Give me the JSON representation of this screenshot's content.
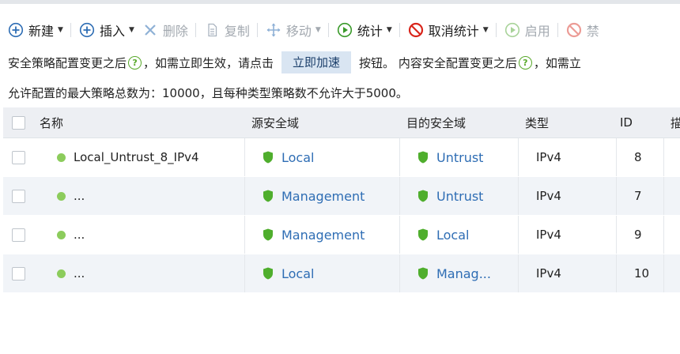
{
  "toolbar": {
    "items": [
      {
        "label": "新建",
        "icon": "plus-circle-icon",
        "disabled": false,
        "dropdown": true
      },
      {
        "label": "插入",
        "icon": "plus-circle-icon",
        "disabled": false,
        "dropdown": true
      },
      {
        "label": "删除",
        "icon": "x-icon",
        "disabled": true,
        "dropdown": false
      },
      {
        "label": "复制",
        "icon": "copy-icon",
        "disabled": true,
        "dropdown": false
      },
      {
        "label": "移动",
        "icon": "move-icon",
        "disabled": true,
        "dropdown": true
      },
      {
        "label": "统计",
        "icon": "play-circle-icon",
        "disabled": false,
        "dropdown": true
      },
      {
        "label": "取消统计",
        "icon": "no-entry-icon",
        "disabled": false,
        "dropdown": true
      },
      {
        "label": "启用",
        "icon": "play-circle-icon",
        "disabled": true,
        "dropdown": false
      },
      {
        "label": "禁",
        "icon": "no-entry-icon",
        "disabled": true,
        "dropdown": false
      }
    ]
  },
  "info": {
    "part1": "安全策略配置变更之后",
    "part2": "，如需立即生效，请点击",
    "accelerate_button": "立即加速",
    "part3": "按钮。 内容安全配置变更之后",
    "part4": "，如需立"
  },
  "limit_text": "允许配置的最大策略总数为：10000，且每种类型策略数不允许大于5000。",
  "table": {
    "headers": {
      "name": "名称",
      "source_zone": "源安全域",
      "dest_zone": "目的安全域",
      "type": "类型",
      "id": "ID",
      "more": "描"
    },
    "rows": [
      {
        "name": "Local_Untrust_8_IPv4",
        "source_zone": "Local",
        "dest_zone": "Untrust",
        "type": "IPv4",
        "id": "8"
      },
      {
        "name": "...",
        "source_zone": "Management",
        "dest_zone": "Untrust",
        "type": "IPv4",
        "id": "7"
      },
      {
        "name": "...",
        "source_zone": "Management",
        "dest_zone": "Local",
        "type": "IPv4",
        "id": "9"
      },
      {
        "name": "...",
        "source_zone": "Local",
        "dest_zone": "Manag...",
        "type": "IPv4",
        "id": "10"
      }
    ]
  },
  "colors": {
    "accent_blue": "#2e6db4",
    "status_green": "#8ccc5c",
    "shield_green": "#4fae2d",
    "stop_red": "#d9261c",
    "help_green": "#58a82a"
  }
}
